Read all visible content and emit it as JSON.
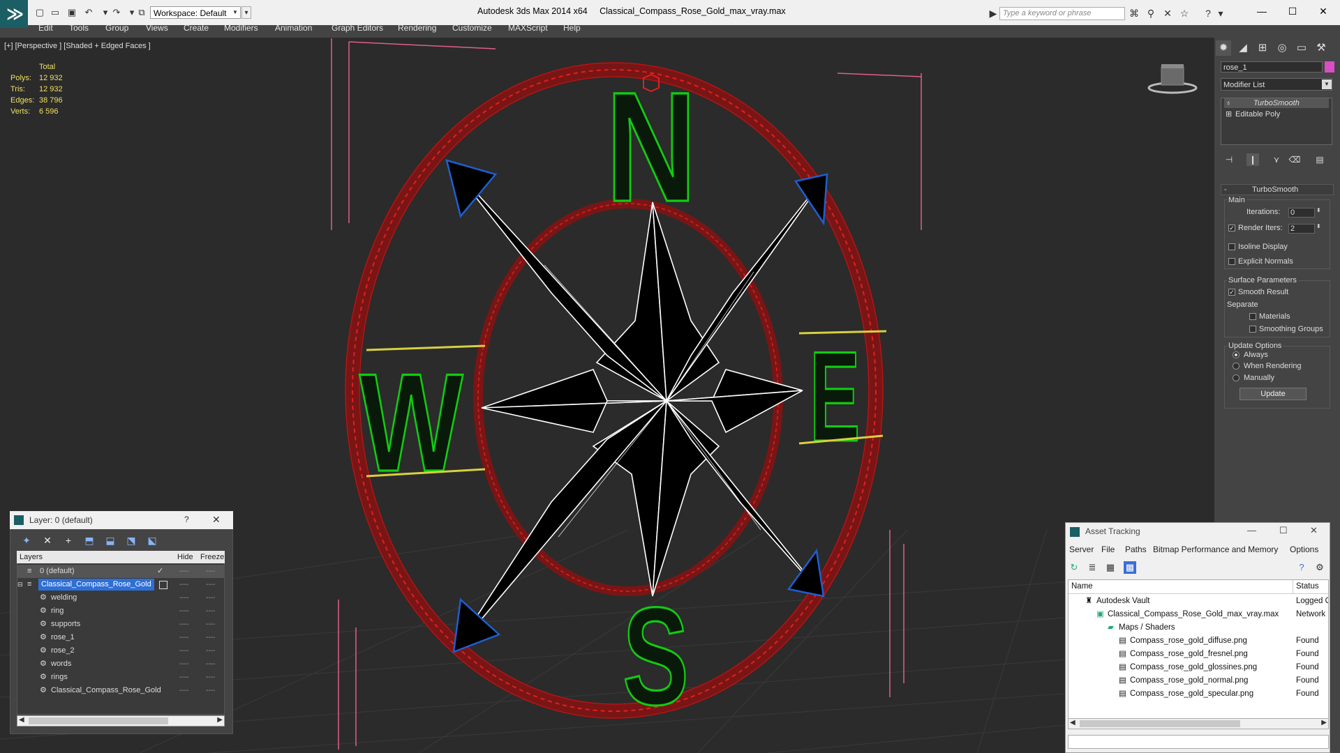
{
  "titlebar": {
    "workspace": "Workspace: Default",
    "app": "Autodesk 3ds Max  2014 x64",
    "file": "Classical_Compass_Rose_Gold_max_vray.max",
    "search_placeholder": "Type a keyword or phrase"
  },
  "menu": [
    "Edit",
    "Tools",
    "Group",
    "Views",
    "Create",
    "Modifiers",
    "Animation",
    "Graph Editors",
    "Rendering",
    "Customize",
    "MAXScript",
    "Help"
  ],
  "viewport": {
    "label": "[+] [Perspective ] [Shaded + Edged Faces ]",
    "stats_header": "Total",
    "stats": [
      {
        "label": "Polys:",
        "value": "12 932"
      },
      {
        "label": "Tris:",
        "value": "12 932"
      },
      {
        "label": "Edges:",
        "value": "38 796"
      },
      {
        "label": "Verts:",
        "value": "6 596"
      }
    ],
    "letters": {
      "n": "N",
      "s": "S",
      "e": "E",
      "w": "W"
    },
    "colors": {
      "ring": "#7a1515",
      "ring_wire": "#e02020",
      "letters": "#11cc11",
      "star_fill": "#000000",
      "star_wire": "#ffffff",
      "tips": "#1e5fd0",
      "bbox": "#e06088"
    }
  },
  "command_panel": {
    "object_name": "rose_1",
    "object_color": "#d94ec4",
    "modifier_list": "Modifier List",
    "stack": [
      "TurboSmooth",
      "Editable Poly"
    ],
    "rollout_title": "TurboSmooth",
    "main_label": "Main",
    "iterations_label": "Iterations:",
    "iterations_value": "0",
    "render_iters_label": "Render Iters:",
    "render_iters_value": "2",
    "isoline": "Isoline Display",
    "explicit_normals": "Explicit Normals",
    "surface_params": "Surface Parameters",
    "smooth_result": "Smooth Result",
    "separate": "Separate",
    "materials": "Materials",
    "smoothing_groups": "Smoothing Groups",
    "update_options": "Update Options",
    "always": "Always",
    "when_rendering": "When Rendering",
    "manually": "Manually",
    "update_button": "Update"
  },
  "layer_window": {
    "title": "Layer: 0 (default)",
    "help": "?",
    "col_layers": "Layers",
    "col_hide": "Hide",
    "col_freeze": "Freeze",
    "rows": [
      {
        "name": "0 (default)"
      },
      {
        "name": "Classical_Compass_Rose_Gold"
      },
      {
        "name": "welding"
      },
      {
        "name": "ring"
      },
      {
        "name": "supports"
      },
      {
        "name": "rose_1"
      },
      {
        "name": "rose_2"
      },
      {
        "name": "words"
      },
      {
        "name": "rings"
      },
      {
        "name": "Classical_Compass_Rose_Gold"
      }
    ],
    "dash": "----"
  },
  "asset_tracking": {
    "title": "Asset Tracking",
    "menu": [
      "Server",
      "File",
      "Paths",
      "Bitmap Performance and Memory",
      "Options"
    ],
    "col_name": "Name",
    "col_status": "Status",
    "rows": [
      {
        "name": "Autodesk Vault",
        "status": "Logged Out"
      },
      {
        "name": "Classical_Compass_Rose_Gold_max_vray.max",
        "status": "Network"
      },
      {
        "name": "Maps / Shaders",
        "status": ""
      },
      {
        "name": "Compass_rose_gold_diffuse.png",
        "status": "Found"
      },
      {
        "name": "Compass_rose_gold_fresnel.png",
        "status": "Found"
      },
      {
        "name": "Compass_rose_gold_glossines.png",
        "status": "Found"
      },
      {
        "name": "Compass_rose_gold_normal.png",
        "status": "Found"
      },
      {
        "name": "Compass_rose_gold_specular.png",
        "status": "Found"
      }
    ]
  }
}
